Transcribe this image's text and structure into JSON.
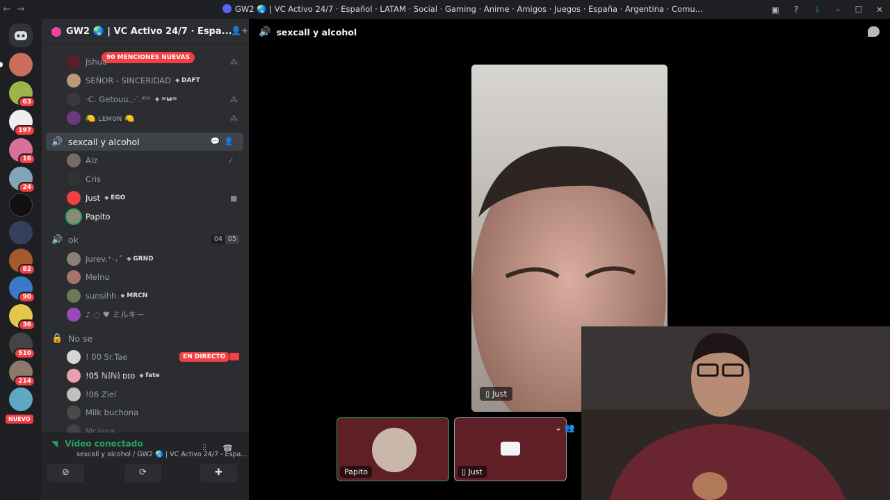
{
  "window": {
    "title": "GW2 🌏 | VC Activo 24/7 · Español · LATAM · Social · Gaming · Anime · Amigos · Juegos · España · Argentina · Comu...",
    "back_icon": "arrow-left-icon",
    "forward_icon": "arrow-right-icon"
  },
  "rail": {
    "servers": [
      {
        "badge": ""
      },
      {
        "badge": "63"
      },
      {
        "badge": "197"
      },
      {
        "badge": "16"
      },
      {
        "badge": "24"
      },
      {
        "badge": ""
      },
      {
        "badge": ""
      },
      {
        "badge": "82"
      },
      {
        "badge": "90"
      },
      {
        "badge": "36"
      },
      {
        "badge": "510"
      },
      {
        "badge": "214"
      }
    ],
    "new_label": "NUEVO"
  },
  "guild": {
    "name": "GW2 🌏 | VC Activo 24/7 · Espa..."
  },
  "mentions_label": "90 MENCIONES NUEVAS",
  "channels": {
    "top_members": [
      {
        "name": "Jshua",
        "tag": ""
      },
      {
        "name": "SEÑOR - SINCERIDAD",
        "tag": "DAFT"
      },
      {
        "name": "·ᑕ. Getouu.⋰.ᵃᵇᶜ",
        "tag": "=ω="
      },
      {
        "name": "🍋 ʟᴇᴍᴏɴ 🍋",
        "tag": ""
      }
    ],
    "active_voice": {
      "name": "sexcall y alcohol",
      "members": [
        {
          "name": "Aiz",
          "tag": ""
        },
        {
          "name": "Cris",
          "tag": ""
        },
        {
          "name": "Just",
          "tag": "EGO"
        },
        {
          "name": "Papito",
          "tag": ""
        }
      ]
    },
    "ok_voice": {
      "name": "ok",
      "count_a": "04",
      "count_b": "05",
      "members": [
        {
          "name": "Jurev.⁺‧₊˚",
          "tag": "GRND"
        },
        {
          "name": "Melnu",
          "tag": ""
        },
        {
          "name": "sunsihh",
          "tag": "MRCN"
        },
        {
          "name": "♪ ◌ ♥ ミルキー",
          "tag": ""
        }
      ]
    },
    "nose_voice": {
      "name": "No se",
      "live_label": "EN DIRECTO",
      "members": [
        {
          "name": "! 00 Sr.Tae",
          "tag": ""
        },
        {
          "name": "!05 ℕ𝕚ℕ𝕚 ᴅɪᴏ",
          "tag": "fate"
        },
        {
          "name": "!06 Ziel",
          "tag": ""
        },
        {
          "name": "Milk buchona",
          "tag": ""
        },
        {
          "name": "Mr.Jona",
          "tag": ""
        }
      ]
    }
  },
  "voice_connection": {
    "status": "Vídeo conectado",
    "channel_path": "sexcall y alcohol / GW2 🌏 | VC Activo 24/7 - Espa..."
  },
  "main": {
    "channel_title": "sexcall y alcohol",
    "focused_user": "Just",
    "tiles": [
      {
        "name": "Papito"
      },
      {
        "name": "Just"
      }
    ]
  },
  "colors": {
    "accent": "#5865f2",
    "danger": "#f23f43",
    "online": "#23a55a"
  }
}
